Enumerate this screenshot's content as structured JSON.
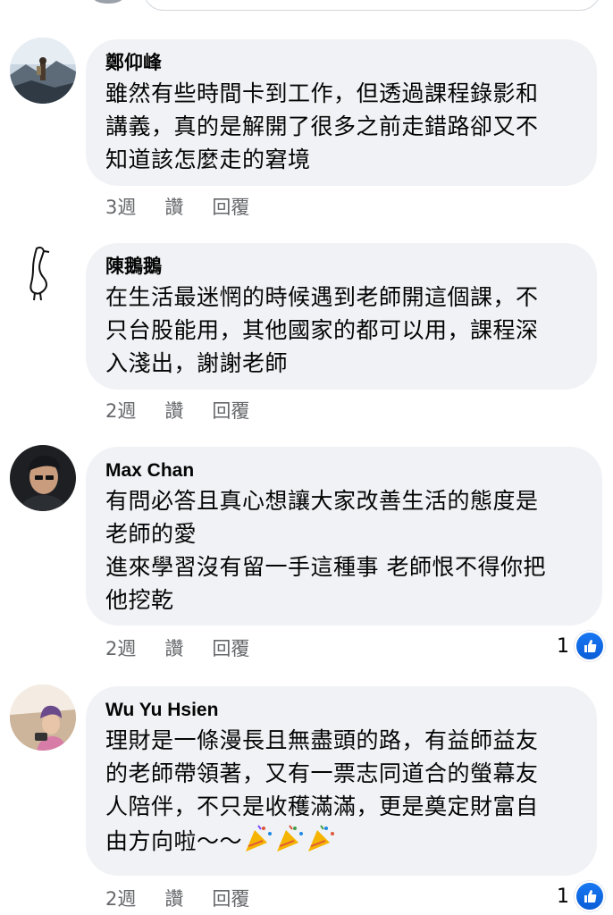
{
  "colors": {
    "bubble": "#f0f2f5",
    "meta": "#65676b",
    "like_blue": "#1877f2"
  },
  "comments": [
    {
      "author": "鄭仰峰",
      "lines": [
        "雖然有些時間卡到工作，但透過課程錄影和",
        "講義，真的是解開了很多之前走錯路卻又不",
        "知道該怎麼走的窘境"
      ],
      "time": "3週",
      "like_label": "讚",
      "reply_label": "回覆",
      "avatar_icon": "mountain-photo-icon"
    },
    {
      "author": "陳鵝鵝",
      "lines": [
        "在生活最迷惘的時候遇到老師開這個課，不",
        "只台股能用，其他國家的都可以用，課程深",
        "入淺出，謝謝老師"
      ],
      "time": "2週",
      "like_label": "讚",
      "reply_label": "回覆",
      "avatar_icon": "goose-drawing-icon"
    },
    {
      "author": "Max Chan",
      "lines": [
        "有問必答且真心想讓大家改善生活的態度是",
        "老師的愛",
        "進來學習沒有留一手這種事 老師恨不得你把",
        "他挖乾"
      ],
      "time": "2週",
      "like_label": "讚",
      "reply_label": "回覆",
      "reaction_count": "1",
      "avatar_icon": "man-photo-icon"
    },
    {
      "author": "Wu Yu Hsien",
      "lines": [
        "理財是一條漫長且無盡頭的路，有益師益友",
        "的老師帶領著，又有一票志同道合的螢幕友",
        "人陪伴，不只是收穫滿滿，更是奠定財富自",
        "由方向啦～～"
      ],
      "emoji": "party-popper-icon",
      "time": "2週",
      "like_label": "讚",
      "reply_label": "回覆",
      "reaction_count": "1",
      "avatar_icon": "girl-photo-icon"
    }
  ]
}
